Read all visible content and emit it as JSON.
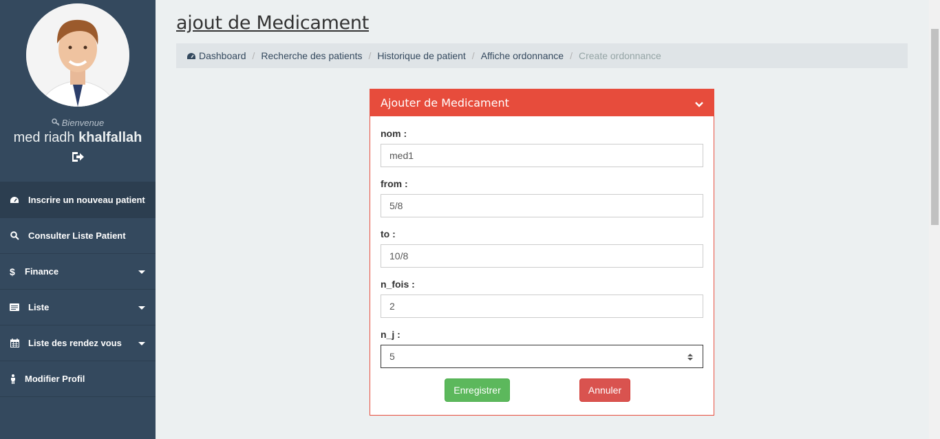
{
  "sidebar": {
    "welcome": "Bienvenue",
    "user_first": "med riadh",
    "user_last": "khalfallah",
    "items": [
      {
        "label": "Inscrire un nouveau patient",
        "icon": "dashboard-icon",
        "active": true,
        "has_caret": false
      },
      {
        "label": "Consulter Liste Patient",
        "icon": "search-icon",
        "active": false,
        "has_caret": false
      },
      {
        "label": "Finance",
        "icon": "dollar-icon",
        "active": false,
        "has_caret": true
      },
      {
        "label": "Liste",
        "icon": "list-icon",
        "active": false,
        "has_caret": true
      },
      {
        "label": "Liste des rendez vous",
        "icon": "calendar-icon",
        "active": false,
        "has_caret": true
      },
      {
        "label": "Modifier Profil",
        "icon": "user-icon",
        "active": false,
        "has_caret": false
      }
    ]
  },
  "page": {
    "title": "ajout de Medicament"
  },
  "breadcrumb": [
    {
      "label": "Dashboard",
      "icon": "dashboard-icon"
    },
    {
      "label": "Recherche des patients"
    },
    {
      "label": "Historique de patient"
    },
    {
      "label": "Affiche ordonnance"
    },
    {
      "label": "Create ordonnance",
      "current": true
    }
  ],
  "form": {
    "title": "Ajouter de Medicament",
    "fields": [
      {
        "label": "nom :",
        "value": "med1"
      },
      {
        "label": "from :",
        "value": "5/8"
      },
      {
        "label": "to :",
        "value": "10/8"
      },
      {
        "label": "n_fois :",
        "value": "2"
      },
      {
        "label": "n_j :",
        "value": "5"
      }
    ],
    "save_label": "Enregistrer",
    "cancel_label": "Annuler"
  },
  "colors": {
    "sidebar": "#34495e",
    "panel_accent": "#e74c3c",
    "save": "#5cb85c",
    "cancel": "#d9534f"
  }
}
